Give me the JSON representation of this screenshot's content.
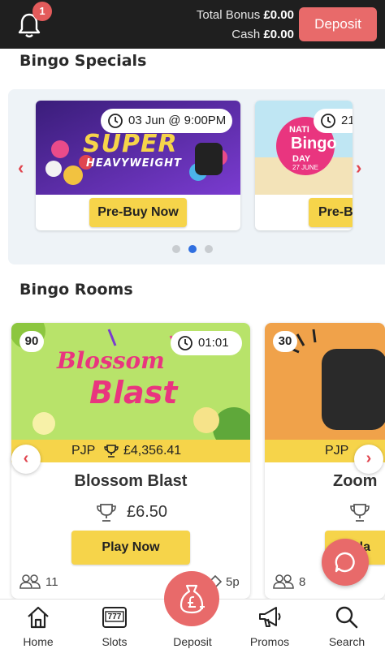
{
  "header": {
    "notification_count": "1",
    "total_bonus_label": "Total Bonus",
    "total_bonus_value": "£0.00",
    "cash_label": "Cash",
    "cash_value": "£0.00",
    "deposit_label": "Deposit"
  },
  "specials": {
    "title": "Bingo Specials",
    "cards": [
      {
        "banner_line1": "SUPER",
        "banner_line2": "HEAVYWEIGHT",
        "time": "03 Jun @ 9:00PM",
        "button": "Pre-Buy Now"
      },
      {
        "banner_line1": "NATI",
        "banner_line2": "Bingo",
        "banner_line3": "DAY",
        "banner_sub": "27 JUNE",
        "time": "21",
        "button": "Pre-B"
      }
    ]
  },
  "rooms": {
    "title": "Bingo Rooms",
    "cards": [
      {
        "count": "90",
        "timer": "01:01",
        "banner_line1": "Blossom",
        "banner_line2": "Blast",
        "pjp_label": "PJP",
        "pjp_value": "£4,356.41",
        "name": "Blossom Blast",
        "prize": "£6.50",
        "play": "Play Now",
        "players": "11",
        "price": "5p"
      },
      {
        "count": "30",
        "pjp_label": "PJP",
        "name": "Zoom",
        "play": "Pla",
        "players": "8"
      }
    ]
  },
  "nav": {
    "home": "Home",
    "slots": "Slots",
    "slots_reels": "777",
    "deposit": "Deposit",
    "promos": "Promos",
    "search": "Search"
  },
  "colors": {
    "accent": "#e86a6a",
    "yellow": "#f6d44a",
    "header_bg": "#1f1f1f"
  }
}
